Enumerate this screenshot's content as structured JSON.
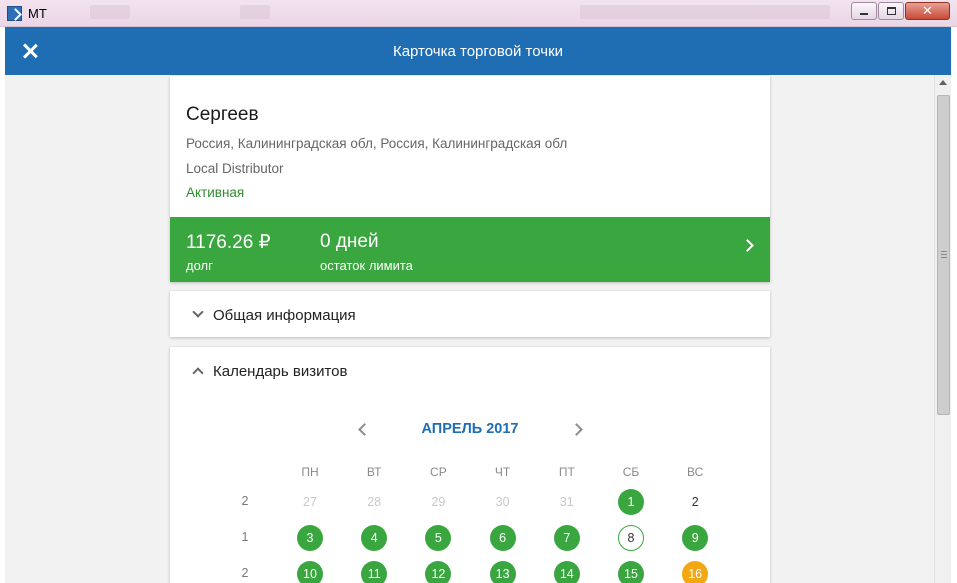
{
  "window": {
    "title": "MT"
  },
  "header": {
    "title": "Карточка торговой точки"
  },
  "outlet": {
    "name": "Сергеев",
    "address": "Россия, Калининградская обл, Россия, Калининградская обл",
    "type": "Local Distributor",
    "status": "Активная",
    "debt_value": "1176.26 ₽",
    "debt_label": "долг",
    "limit_value": "0 дней",
    "limit_label": "остаток лимита"
  },
  "sections": {
    "general_info": "Общая информация",
    "calendar": "Календарь визитов"
  },
  "calendar": {
    "month_label": "АПРЕЛЬ 2017",
    "weekdays": [
      "ПН",
      "ВТ",
      "СР",
      "ЧТ",
      "ПТ",
      "СБ",
      "ВС"
    ],
    "weeks": [
      {
        "week_number": "2",
        "days": [
          {
            "label": "27",
            "state": "muted"
          },
          {
            "label": "28",
            "state": "muted"
          },
          {
            "label": "29",
            "state": "muted"
          },
          {
            "label": "30",
            "state": "muted"
          },
          {
            "label": "31",
            "state": "muted"
          },
          {
            "label": "1",
            "state": "green"
          },
          {
            "label": "2",
            "state": "plain"
          }
        ]
      },
      {
        "week_number": "1",
        "days": [
          {
            "label": "3",
            "state": "green"
          },
          {
            "label": "4",
            "state": "green"
          },
          {
            "label": "5",
            "state": "green"
          },
          {
            "label": "6",
            "state": "green"
          },
          {
            "label": "7",
            "state": "green"
          },
          {
            "label": "8",
            "state": "outline"
          },
          {
            "label": "9",
            "state": "green"
          }
        ]
      },
      {
        "week_number": "2",
        "days": [
          {
            "label": "10",
            "state": "green"
          },
          {
            "label": "11",
            "state": "green"
          },
          {
            "label": "12",
            "state": "green"
          },
          {
            "label": "13",
            "state": "green"
          },
          {
            "label": "14",
            "state": "green"
          },
          {
            "label": "15",
            "state": "green"
          },
          {
            "label": "16",
            "state": "orange"
          }
        ]
      }
    ]
  },
  "colors": {
    "header": "#1f6eb4",
    "debt_bar": "#3aa63f",
    "visit_planned": "#3aa63f",
    "visit_today_outline": "#3aa63f",
    "visit_other": "#f3a712"
  }
}
